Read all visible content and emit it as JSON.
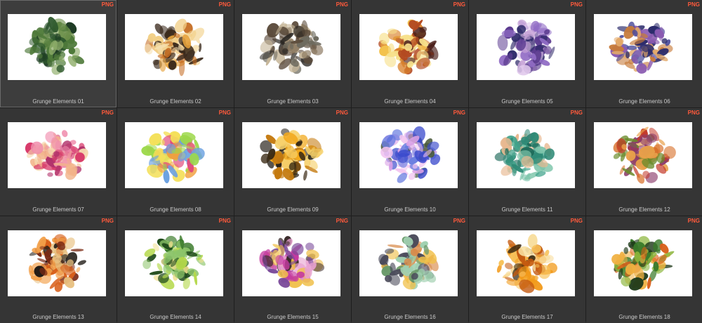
{
  "browser": {
    "badge_label": "PNG",
    "items": [
      {
        "label": "Grunge Elements 01",
        "selected": true,
        "colors": [
          "#2f5a2e",
          "#4f7a3a",
          "#8fae6a",
          "#1c3a22",
          "#6c8f4a"
        ]
      },
      {
        "label": "Grunge Elements 02",
        "selected": false,
        "colors": [
          "#e6a23c",
          "#c46a1f",
          "#f2cf86",
          "#3b2a1c",
          "#f7e2b4"
        ]
      },
      {
        "label": "Grunge Elements 03",
        "selected": false,
        "colors": [
          "#5a4a3a",
          "#8c7a62",
          "#2a2622",
          "#c7b79a",
          "#6d6a5e"
        ]
      },
      {
        "label": "Grunge Elements 04",
        "selected": false,
        "colors": [
          "#f3c24d",
          "#d9812b",
          "#4a1f1a",
          "#f7e08a",
          "#b34a22"
        ]
      },
      {
        "label": "Grunge Elements 05",
        "selected": false,
        "colors": [
          "#5b3b8f",
          "#8f6bc4",
          "#c9a7d9",
          "#2f2a6a",
          "#e0c8ec"
        ]
      },
      {
        "label": "Grunge Elements 06",
        "selected": false,
        "colors": [
          "#c77b3a",
          "#4a4a9a",
          "#e2a868",
          "#2c2c6c",
          "#8a5ab0"
        ]
      },
      {
        "label": "Grunge Elements 07",
        "selected": false,
        "colors": [
          "#d83a6a",
          "#f2b48a",
          "#f6d9b0",
          "#b0306a",
          "#f08cac"
        ]
      },
      {
        "label": "Grunge Elements 08",
        "selected": false,
        "colors": [
          "#9cd84a",
          "#f0a040",
          "#e04a7a",
          "#6aa0e0",
          "#f4e05a"
        ]
      },
      {
        "label": "Grunge Elements 09",
        "selected": false,
        "colors": [
          "#f2a81c",
          "#c47a10",
          "#3a2a14",
          "#f6d06a",
          "#1f1a12"
        ]
      },
      {
        "label": "Grunge Elements 10",
        "selected": false,
        "colors": [
          "#6a7ee0",
          "#d9a0e6",
          "#4a5a3a",
          "#f2c4f0",
          "#3a4acc"
        ]
      },
      {
        "label": "Grunge Elements 11",
        "selected": false,
        "colors": [
          "#2f8a76",
          "#3fa28a",
          "#e8b890",
          "#1f6a5a",
          "#7cc4aa"
        ]
      },
      {
        "label": "Grunge Elements 12",
        "selected": false,
        "colors": [
          "#8a3a6a",
          "#d8702a",
          "#6a8a2a",
          "#c43a2a",
          "#e8a04a"
        ]
      },
      {
        "label": "Grunge Elements 13",
        "selected": false,
        "colors": [
          "#d8601a",
          "#1f1a14",
          "#f2a04a",
          "#7a2a14",
          "#e8c080"
        ]
      },
      {
        "label": "Grunge Elements 14",
        "selected": false,
        "colors": [
          "#3a7a2a",
          "#b4d84a",
          "#f0e090",
          "#1f4a1a",
          "#8cc46a"
        ]
      },
      {
        "label": "Grunge Elements 15",
        "selected": false,
        "colors": [
          "#c43aa0",
          "#f0c04a",
          "#7a4a9a",
          "#3a2a2a",
          "#e8a0d0"
        ]
      },
      {
        "label": "Grunge Elements 16",
        "selected": false,
        "colors": [
          "#6a9a6a",
          "#f0c04a",
          "#d88a4a",
          "#4a4a5a",
          "#a0d0b0"
        ]
      },
      {
        "label": "Grunge Elements 17",
        "selected": false,
        "colors": [
          "#f29a1a",
          "#f7c25a",
          "#c45a10",
          "#3a2a14",
          "#f8dfa0"
        ]
      },
      {
        "label": "Grunge Elements 18",
        "selected": false,
        "colors": [
          "#3a7a2a",
          "#d8601a",
          "#f0b040",
          "#1f3a1a",
          "#8ab43a"
        ]
      }
    ]
  }
}
